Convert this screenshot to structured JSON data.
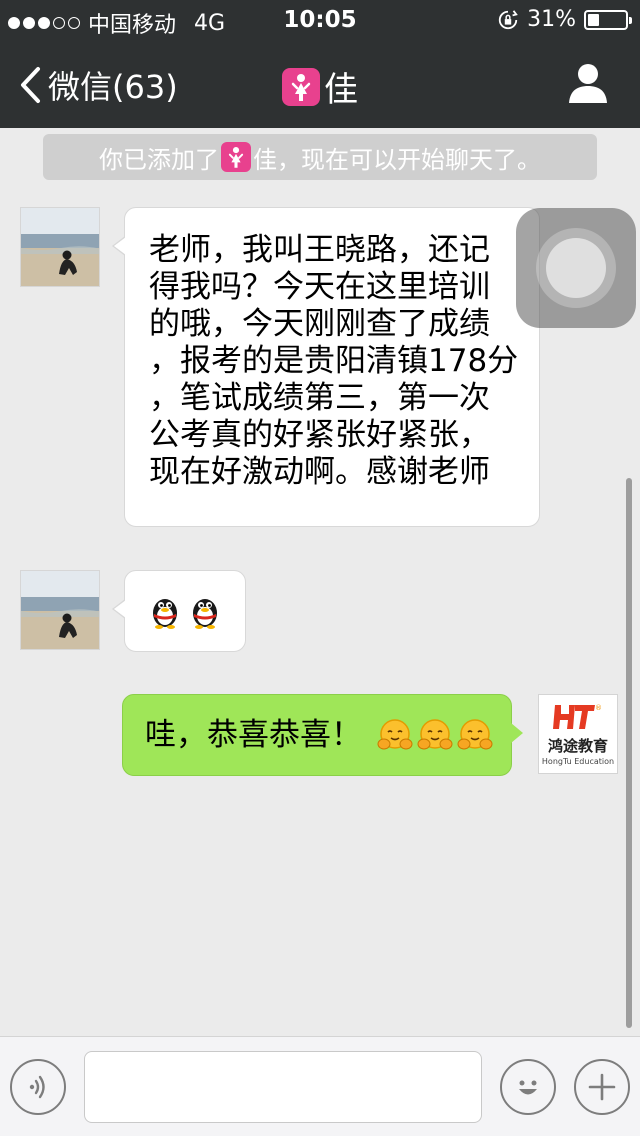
{
  "status_bar": {
    "signal_dots_filled": 3,
    "signal_dots_total": 5,
    "carrier": "中国移动",
    "network": "4G",
    "time": "10:05",
    "battery": "31%",
    "battery_level": 0.31
  },
  "nav": {
    "back_label": "微信(63)",
    "title": "佳",
    "title_badge_icon": "female-symbol-icon",
    "profile_icon": "person-icon"
  },
  "system_notice": {
    "prefix": "你已添加了",
    "name": "佳",
    "suffix": "，现在可以开始聊天了。"
  },
  "messages": [
    {
      "side": "left",
      "lines": [
        "老师，我叫王晓路，还记",
        "得我吗？今天在这里培训",
        "的哦，今天刚刚查了成绩",
        "，报考的是贵阳清镇178分",
        "，笔试成绩第三，第一次",
        "公考真的好紧张好紧张，",
        "现在好激动啊。感谢老师"
      ]
    },
    {
      "side": "left",
      "emojis": [
        "penguin-emoji",
        "penguin-emoji"
      ]
    },
    {
      "side": "right",
      "text": "哇，恭喜恭喜！",
      "emojis": [
        "hug-emoji",
        "hug-emoji",
        "hug-emoji"
      ]
    }
  ],
  "brand_avatar": {
    "logo_text": "HT",
    "name_cn": "鸿途教育",
    "name_en": "HongTu Education"
  },
  "input_bar": {
    "text_value": "",
    "voice_icon": "voice-icon",
    "emoji_icon": "smiley-icon",
    "more_icon": "plus-icon"
  },
  "colors": {
    "nav_bg": "#2e3132",
    "chat_bg": "#ebebeb",
    "sent_bubble": "#9fe658",
    "received_bubble": "#ffffff",
    "badge_pink": "#e8418e"
  }
}
